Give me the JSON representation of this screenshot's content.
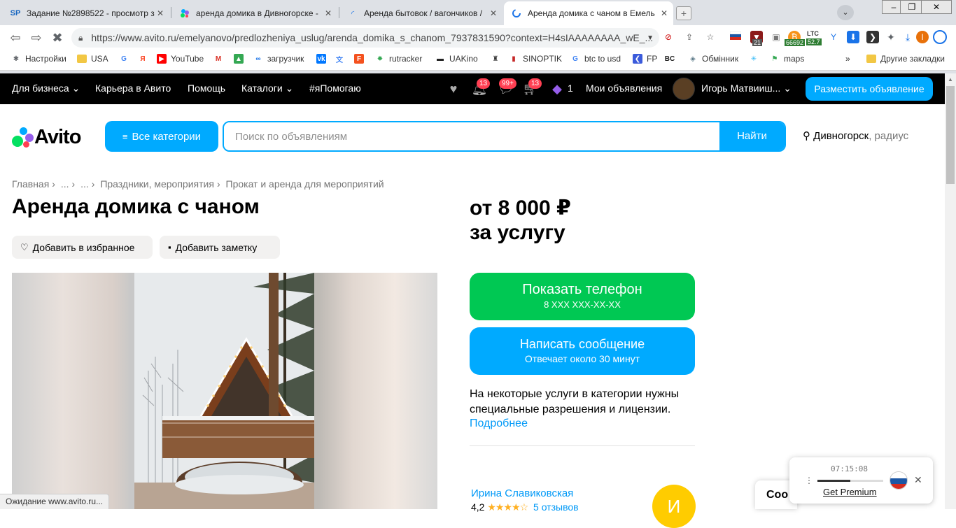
{
  "browser": {
    "tabs": [
      {
        "title": "Задание №2898522 - просмотр з",
        "favicon": "SP"
      },
      {
        "title": "аренда домика в Дивногорске - ",
        "favicon": "avito-dots"
      },
      {
        "title": "Аренда бытовок / вагончиков / ",
        "favicon": "loading"
      },
      {
        "title": "Аренда домика с чаном в Емель",
        "favicon": "loading"
      }
    ],
    "url": "https://www.avito.ru/emelyanovo/predlozheniya_uslug/arenda_domika_s_chanom_7937831590?context=H4sIAAAAAAAA_wE_...",
    "extension_badges": {
      "ext1": "21",
      "btc": "66692",
      "ltc_label": "LTC",
      "ltc": "52.7",
      "profile_letter": "I"
    },
    "bookmarks": [
      {
        "label": "Настройки",
        "icon": "gear-icon"
      },
      {
        "label": "USA",
        "icon": "folder-icon"
      },
      {
        "label": "",
        "icon": "google-icon"
      },
      {
        "label": "",
        "icon": "yandex-icon"
      },
      {
        "label": "YouTube",
        "icon": "youtube-icon"
      },
      {
        "label": "",
        "icon": "gmail-icon"
      },
      {
        "label": "",
        "icon": "drive-icon"
      },
      {
        "label": "загрузчик",
        "icon": "infinity-icon"
      },
      {
        "label": "",
        "icon": "vk-icon"
      },
      {
        "label": "",
        "icon": "translate-icon"
      },
      {
        "label": "",
        "icon": "f-icon"
      },
      {
        "label": "rutracker",
        "icon": "rutracker-icon"
      },
      {
        "label": "UAKino",
        "icon": "uakino-icon"
      },
      {
        "label": "",
        "icon": "person-icon"
      },
      {
        "label": "SINOPTIK",
        "icon": "thermometer-icon"
      },
      {
        "label": "btc to usd",
        "icon": "google-icon"
      },
      {
        "label": "FP",
        "icon": "fp-icon"
      },
      {
        "label": "",
        "icon": "bc-icon"
      },
      {
        "label": "Обмінник",
        "icon": "exchange-icon"
      },
      {
        "label": "",
        "icon": "star-icon"
      },
      {
        "label": "maps",
        "icon": "maps-icon"
      }
    ],
    "bookmarks_overflow": "»",
    "other_bookmarks": "Другие закладки",
    "status_text": "Ожидание www.avito.ru..."
  },
  "header": {
    "nav": [
      {
        "label": "Для бизнеса",
        "dropdown": true
      },
      {
        "label": "Карьера в Авито",
        "dropdown": false
      },
      {
        "label": "Помощь",
        "dropdown": false
      },
      {
        "label": "Каталоги",
        "dropdown": true
      },
      {
        "label": "#яПомогаю",
        "dropdown": false
      }
    ],
    "badges": {
      "notifications": "13",
      "messages": "99+",
      "cart": "13",
      "promo": "1"
    },
    "my_ads": "Мои объявления",
    "user_name": "Игорь Матвииш...",
    "post_button": "Разместить объявление"
  },
  "search": {
    "logo": "Avito",
    "categories_button": "Все категории",
    "placeholder": "Поиск по объявлениям",
    "find_button": "Найти",
    "location": "Дивногорск",
    "radius": ", радиус"
  },
  "breadcrumbs": [
    "Главная",
    "...",
    "...",
    "Праздники, мероприятия",
    "Прокат и аренда для мероприятий"
  ],
  "listing": {
    "title": "Аренда домика с чаном",
    "add_favorite": "Добавить в избранное",
    "add_note": "Добавить заметку",
    "price_line1": "от 8 000 ₽",
    "price_line2": "за услугу",
    "show_phone": "Показать телефон",
    "phone_masked": "8 XXX XXX-XX-XX",
    "write_message": "Написать сообщение",
    "response_time": "Отвечает около 30 минут",
    "license_note": "На некоторые услуги в категории нужны специальные разрешения и лицензии.",
    "more_link": "Подробнее",
    "seller_name": "Ирина Славиковская",
    "seller_rating": "4,2",
    "rating_stars": 4,
    "reviews": "5 отзывов",
    "seller_initial": "И"
  },
  "widgets": {
    "chat_label": "Coo",
    "player_time": "07:15:08",
    "player_progress": 0.5,
    "player_premium": "Get Premium"
  },
  "colors": {
    "accent": "#00aaff",
    "green": "#00c853",
    "header_bg": "#000000",
    "link": "#0099f7",
    "badge": "#ff4053"
  }
}
